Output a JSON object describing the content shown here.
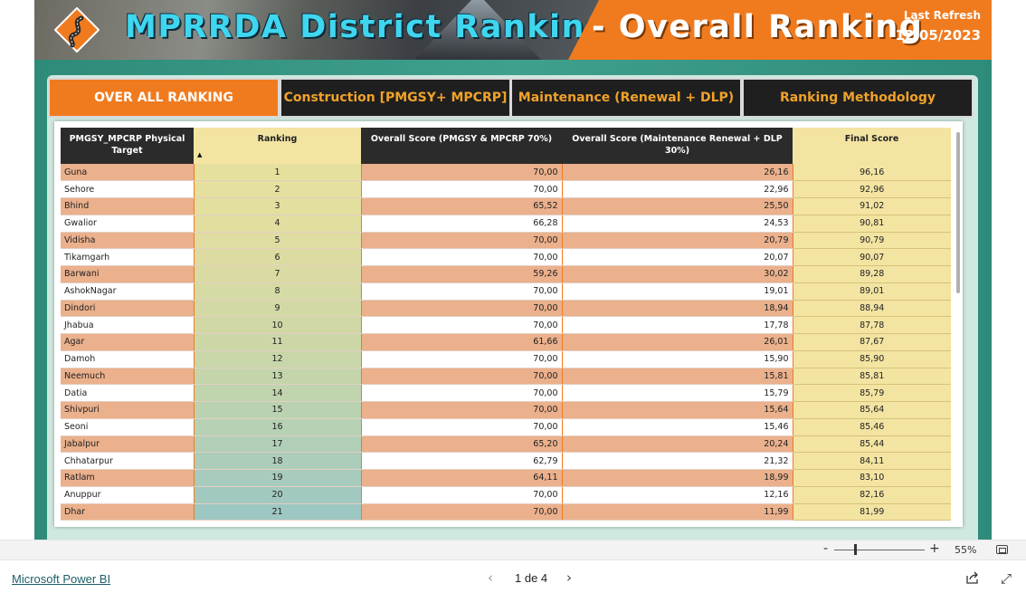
{
  "banner": {
    "title": "MPRRDA District Ranking",
    "subtitle": "- Overall Ranking",
    "last_refresh_label": "Last Refresh",
    "last_refresh_date": "12/05/2023"
  },
  "tabs": [
    {
      "label": "OVER ALL RANKING",
      "active": true
    },
    {
      "label": "Construction [PMGSY+ MPCRP]",
      "active": false
    },
    {
      "label": "Maintenance (Renewal + DLP)",
      "active": false
    },
    {
      "label": "Ranking Methodology",
      "active": false
    }
  ],
  "table": {
    "columns": [
      "PMGSY_MPCRP Physical Target",
      "Ranking",
      "Overall Score (PMGSY & MPCRP 70%)",
      "Overall Score (Maintenance Renewal + DLP 30%)",
      "Final Score"
    ],
    "rows": [
      [
        "Guna",
        "1",
        "70,00",
        "26,16",
        "96,16"
      ],
      [
        "Sehore",
        "2",
        "70,00",
        "22,96",
        "92,96"
      ],
      [
        "Bhind",
        "3",
        "65,52",
        "25,50",
        "91,02"
      ],
      [
        "Gwalior",
        "4",
        "66,28",
        "24,53",
        "90,81"
      ],
      [
        "Vidisha",
        "5",
        "70,00",
        "20,79",
        "90,79"
      ],
      [
        "Tikamgarh",
        "6",
        "70,00",
        "20,07",
        "90,07"
      ],
      [
        "Barwani",
        "7",
        "59,26",
        "30,02",
        "89,28"
      ],
      [
        "AshokNagar",
        "8",
        "70,00",
        "19,01",
        "89,01"
      ],
      [
        "Dindori",
        "9",
        "70,00",
        "18,94",
        "88,94"
      ],
      [
        "Jhabua",
        "10",
        "70,00",
        "17,78",
        "87,78"
      ],
      [
        "Agar",
        "11",
        "61,66",
        "26,01",
        "87,67"
      ],
      [
        "Damoh",
        "12",
        "70,00",
        "15,90",
        "85,90"
      ],
      [
        "Neemuch",
        "13",
        "70,00",
        "15,81",
        "85,81"
      ],
      [
        "Datia",
        "14",
        "70,00",
        "15,79",
        "85,79"
      ],
      [
        "Shivpuri",
        "15",
        "70,00",
        "15,64",
        "85,64"
      ],
      [
        "Seoni",
        "16",
        "70,00",
        "15,46",
        "85,46"
      ],
      [
        "Jabalpur",
        "17",
        "65,20",
        "20,24",
        "85,44"
      ],
      [
        "Chhatarpur",
        "18",
        "62,79",
        "21,32",
        "84,11"
      ],
      [
        "Ratlam",
        "19",
        "64,11",
        "18,99",
        "83,10"
      ],
      [
        "Anuppur",
        "20",
        "70,00",
        "12,16",
        "82,16"
      ],
      [
        "Dhar",
        "21",
        "70,00",
        "11,99",
        "81,99"
      ]
    ]
  },
  "zoom": {
    "minus": "-",
    "plus": "+",
    "percent": "55%"
  },
  "footer": {
    "brand_link": "Microsoft Power BI",
    "pager_text": "1 de 4",
    "prev": "‹",
    "next": "›"
  },
  "colors": {
    "accent_orange": "#f07b1f",
    "row_salmon": "#ebb08c",
    "final_score_bg": "#f3e4a2",
    "header_dark": "#2b2b2b",
    "teal_bg": "#3fa08d"
  }
}
